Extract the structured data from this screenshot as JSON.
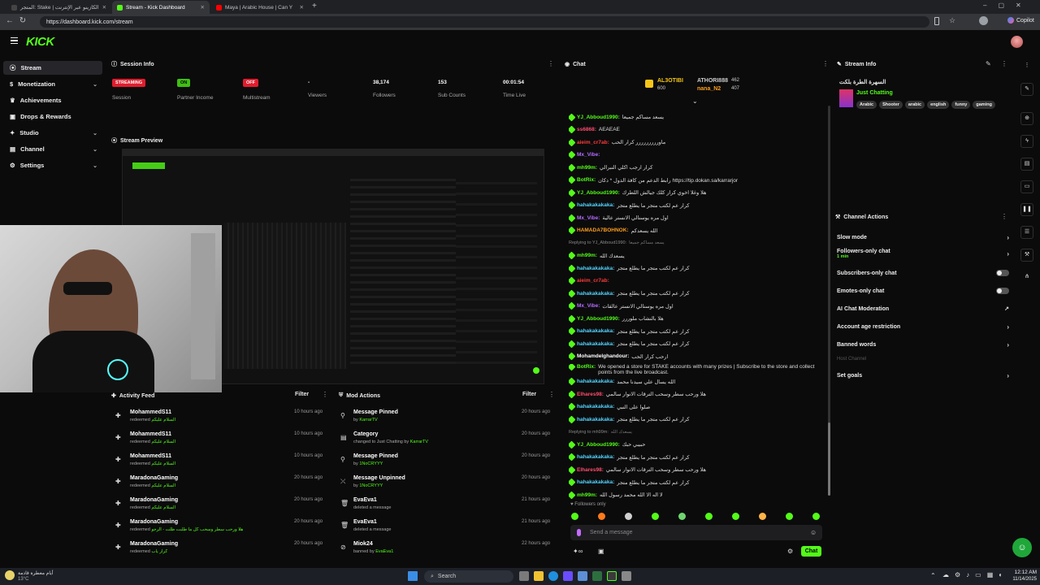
{
  "browser": {
    "tabs": [
      {
        "title": "المتجر: Stake | الكازينو عبر الإنترنت"
      },
      {
        "title": "Stream - Kick Dashboard"
      },
      {
        "title": "Maya | Arabic House | Can Y"
      }
    ],
    "url": "https://dashboard.kick.com/stream",
    "copilot": "Copilot"
  },
  "app": {
    "logo": "KICK"
  },
  "sidebar": {
    "items": [
      {
        "label": "Stream"
      },
      {
        "label": "Monetization"
      },
      {
        "label": "Achievements"
      },
      {
        "label": "Drops & Rewards"
      },
      {
        "label": "Studio"
      },
      {
        "label": "Channel"
      },
      {
        "label": "Settings"
      }
    ]
  },
  "session": {
    "title": "Session Info",
    "stats": [
      {
        "value": "STREAMING",
        "label": "Session"
      },
      {
        "value": "ON",
        "label": "Partner Income"
      },
      {
        "value": "OFF",
        "label": "Multistream"
      },
      {
        "value": "-",
        "label": "Viewers"
      },
      {
        "value": "38,174",
        "label": "Followers"
      },
      {
        "value": "153",
        "label": "Sub Counts"
      },
      {
        "value": "00:01:54",
        "label": "Time Live"
      }
    ]
  },
  "preview": {
    "title": "Stream Preview"
  },
  "activity": {
    "title": "Activity Feed",
    "filter": "Filter",
    "rows": [
      {
        "name": "MohammedS11",
        "sub": "redeemed",
        "reward": "السلام عليكم",
        "time": "10 hours ago"
      },
      {
        "name": "MohammedS11",
        "sub": "redeemed",
        "reward": "السلام عليكم",
        "time": "10 hours ago"
      },
      {
        "name": "MohammedS11",
        "sub": "redeemed",
        "reward": "السلام عليكم",
        "time": "10 hours ago"
      },
      {
        "name": "MaradonaGaming",
        "sub": "redeemed",
        "reward": "السلام عليكم",
        "time": "20 hours ago"
      },
      {
        "name": "MaradonaGaming",
        "sub": "redeemed",
        "reward": "السلام عليكم",
        "time": "20 hours ago"
      },
      {
        "name": "MaradonaGaming",
        "sub": "redeemed",
        "reward": "هلا ورحب سطر وسحب كل ما طلبت ظلت - الرجو",
        "time": "20 hours ago"
      },
      {
        "name": "MaradonaGaming",
        "sub": "redeemed",
        "reward": "كرار ياب",
        "time": "20 hours ago"
      }
    ]
  },
  "mod": {
    "title": "Mod Actions",
    "filter": "Filter",
    "rows": [
      {
        "action": "Message Pinned",
        "sub": "by",
        "who": "KarrarTV",
        "time": "20 hours ago"
      },
      {
        "action": "Category",
        "sub": "changed to Just Chatting by",
        "who": "KarrarTV",
        "time": "20 hours ago"
      },
      {
        "action": "Message Pinned",
        "sub": "by",
        "who": "1NoCRYYY",
        "time": "20 hours ago"
      },
      {
        "action": "Message Unpinned",
        "sub": "by",
        "who": "1NoCRYYY",
        "time": "20 hours ago"
      },
      {
        "action": "EvaEva1",
        "sub": "deleted a message",
        "who": "",
        "time": "21 hours ago"
      },
      {
        "action": "EvaEva1",
        "sub": "deleted a message",
        "who": "",
        "time": "21 hours ago"
      },
      {
        "action": "Miok24",
        "sub": "banned by",
        "who": "EvaEva1",
        "time": "22 hours ago"
      }
    ]
  },
  "chat": {
    "title": "Chat",
    "top": [
      {
        "name": "AL3OTIBI",
        "value": "600"
      },
      {
        "name": "ATHORI888",
        "value": "462"
      },
      {
        "name": "nana_N2",
        "value": "407"
      }
    ],
    "lines": [
      {
        "user": "YJ_Abboud1990:",
        "color": "#53fc18",
        "text": "يسعد مساكم جميعا"
      },
      {
        "user": "ss6868:",
        "color": "#ff4d6d",
        "text": "AEAEAE"
      },
      {
        "user": "aieim_cr7ab:",
        "color": "#ff3b3b",
        "text": "ماوررررررررر كرار الحب"
      },
      {
        "user": "Mx_Vibe:",
        "color": "#b66bff",
        "text": ""
      },
      {
        "user": "mh99m:",
        "color": "#53fc18",
        "text": "كرار ارجب اكلي النبرالي"
      },
      {
        "user": "BotRix:",
        "color": "#53fc18",
        "text": "رابط الدعم من كافة الدول * دكان https://tip.dokan.sa/karrarjor"
      },
      {
        "user": "YJ_Abboud1990:",
        "color": "#53fc18",
        "text": "هلا وغلا اخوي كرار كلك جيالش اللطرك"
      },
      {
        "user": "hahakakakaka:",
        "color": "#53d5ff",
        "text": "كرار عم لكتب متجر ما يطلع متجر"
      },
      {
        "user": "Mx_Vibe:",
        "color": "#b66bff",
        "text": "اول مره يوسنالي الانستر عالية"
      },
      {
        "user": "HAMADA7BOHNOK:",
        "color": "#ff9f1c",
        "text": "الله يسعدكم"
      },
      {
        "user": "Replying to YJ_Abboud1990:",
        "color": "#888888",
        "text": "يسعد مساكم جميعا"
      },
      {
        "user": "mh99m:",
        "color": "#53fc18",
        "text": "يسعدك الله"
      },
      {
        "user": "hahakakakaka:",
        "color": "#53d5ff",
        "text": "كرار عم لكتب متجر ما يطلع متجر"
      },
      {
        "user": "aieim_cr7ab:",
        "color": "#ff3b3b",
        "text": ""
      },
      {
        "user": "hahakakakaka:",
        "color": "#53d5ff",
        "text": "كرار عم لكتب متجر ما يطلع متجر"
      },
      {
        "user": "Mx_Vibe:",
        "color": "#b66bff",
        "text": "اول مره يوسنالي الانستر عالقات"
      },
      {
        "user": "YJ_Abboud1990:",
        "color": "#53fc18",
        "text": "هلا بالنشاب ملوررر"
      },
      {
        "user": "hahakakakaka:",
        "color": "#53d5ff",
        "text": "كرار عم لكتب متجر ما يطلع متجر"
      },
      {
        "user": "hahakakakaka:",
        "color": "#53d5ff",
        "text": "كرار عم لكتب متجر ما يطلع متجر"
      },
      {
        "user": "Mohamdelghandour:",
        "color": "#ffffff",
        "text": "ارحب كرار الحب"
      },
      {
        "user": "BotRix:",
        "color": "#53fc18",
        "text": "We opened a store for STAKE accounts with many prizes | Subscribe to the store and collect points from the live broadcast."
      },
      {
        "user": "hahakakakaka:",
        "color": "#53d5ff",
        "text": "الله يسال علي سيدنا محمد"
      },
      {
        "user": "Elhares98:",
        "color": "#ff4d6d",
        "text": "هلا ورحب سطر وسحب الترقات الانوار سالمي"
      },
      {
        "user": "hahakakakaka:",
        "color": "#53d5ff",
        "text": "صلوا على النبي"
      },
      {
        "user": "hahakakakaka:",
        "color": "#53d5ff",
        "text": "كرار عم لكتب متجر ما يطلع متجر"
      },
      {
        "user": "Replying to mh99m:",
        "color": "#888888",
        "text": "يسعدك الله"
      },
      {
        "user": "YJ_Abboud1990:",
        "color": "#53fc18",
        "text": "حبيبي حبك"
      },
      {
        "user": "hahakakakaka:",
        "color": "#53d5ff",
        "text": "كرار عم لكتب متجر ما يطلع متجر"
      },
      {
        "user": "Elhares98:",
        "color": "#ff4d6d",
        "text": "هلا ورحب سطر وسحب الترقات الانوار سالمي"
      },
      {
        "user": "hahakakakaka:",
        "color": "#53d5ff",
        "text": "كرار عم لكتب متجر ما يطلع متجر"
      },
      {
        "user": "mh99m:",
        "color": "#53fc18",
        "text": "لا اله الا الله محمد رسول الله"
      }
    ],
    "followers_only": "Followers only",
    "placeholder": "Send a message",
    "send": "Chat"
  },
  "stream_info": {
    "title": "Stream Info",
    "stream_title": "السهرة الطرة بلكت",
    "category": "Just Chatting",
    "tags": [
      "Arabic",
      "Shooter",
      "arabic",
      "english",
      "funny",
      "gaming"
    ]
  },
  "channel_actions": {
    "title": "Channel Actions",
    "items": [
      {
        "label": "Slow mode",
        "kind": "chevron",
        "sub": ""
      },
      {
        "label": "Followers-only chat",
        "kind": "chevron",
        "sub": "1 min"
      },
      {
        "label": "Subscribers-only chat",
        "kind": "toggle",
        "sub": ""
      },
      {
        "label": "Emotes-only chat",
        "kind": "toggle",
        "sub": ""
      },
      {
        "label": "AI Chat Moderation",
        "kind": "external",
        "sub": ""
      },
      {
        "label": "Account age restriction",
        "kind": "chevron",
        "sub": ""
      },
      {
        "label": "Banned words",
        "kind": "chevron",
        "sub": ""
      },
      {
        "label": "Host Channel",
        "kind": "disabled",
        "sub": ""
      },
      {
        "label": "Set goals",
        "kind": "chevron",
        "sub": ""
      }
    ]
  },
  "taskbar": {
    "weather": "أيام معطرة قادمة",
    "temp": "13°C",
    "search": "Search",
    "time": "12:12 AM",
    "date": "11/14/2025"
  }
}
